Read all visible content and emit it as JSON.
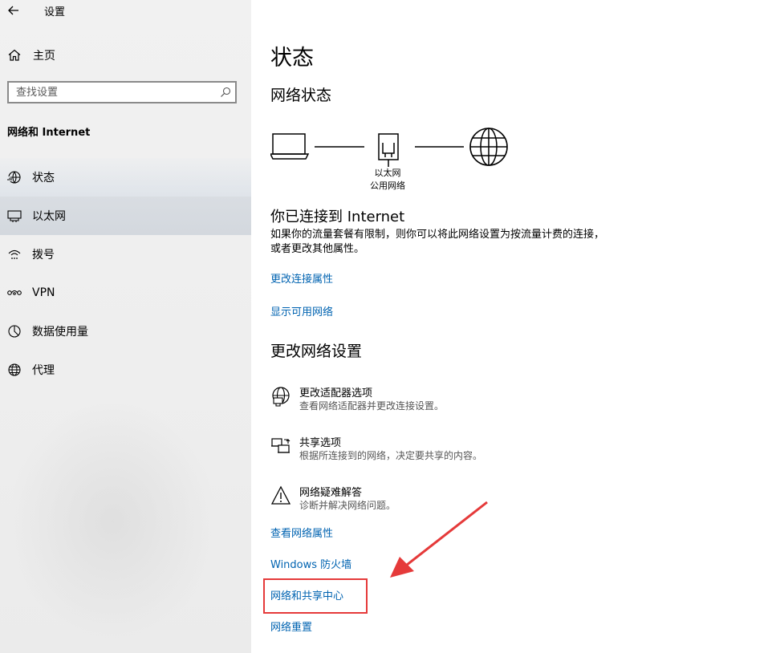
{
  "window": {
    "title": "设置"
  },
  "sidebar": {
    "home_label": "主页",
    "search_placeholder": "查找设置",
    "section_title": "网络和 Internet",
    "items": [
      {
        "label": "状态",
        "icon": "status-icon"
      },
      {
        "label": "以太网",
        "icon": "ethernet-icon",
        "selected": true
      },
      {
        "label": "拨号",
        "icon": "dialup-icon"
      },
      {
        "label": "VPN",
        "icon": "vpn-icon"
      },
      {
        "label": "数据使用量",
        "icon": "data-usage-icon"
      },
      {
        "label": "代理",
        "icon": "globe-icon"
      }
    ]
  },
  "main": {
    "title": "状态",
    "network_status_heading": "网络状态",
    "diagram": {
      "adapter_label": "以太网",
      "network_label": "公用网络"
    },
    "connected_title": "你已连接到 Internet",
    "connected_desc": "如果你的流量套餐有限制，则你可以将此网络设置为按流量计费的连接，或者更改其他属性。",
    "links_top": [
      "更改连接属性",
      "显示可用网络"
    ],
    "change_settings_heading": "更改网络设置",
    "options": [
      {
        "title": "更改适配器选项",
        "subtitle": "查看网络适配器并更改连接设置。",
        "icon": "adapter-icon"
      },
      {
        "title": "共享选项",
        "subtitle": "根据所连接到的网络，决定要共享的内容。",
        "icon": "sharing-icon"
      },
      {
        "title": "网络疑难解答",
        "subtitle": "诊断并解决网络问题。",
        "icon": "warning-icon"
      }
    ],
    "links_bottom": [
      "查看网络属性",
      "Windows 防火墙",
      "网络和共享中心",
      "网络重置"
    ]
  },
  "colors": {
    "link": "#0063b1",
    "highlight": "#e53a3a",
    "selected_bg": "#d3d8de"
  }
}
